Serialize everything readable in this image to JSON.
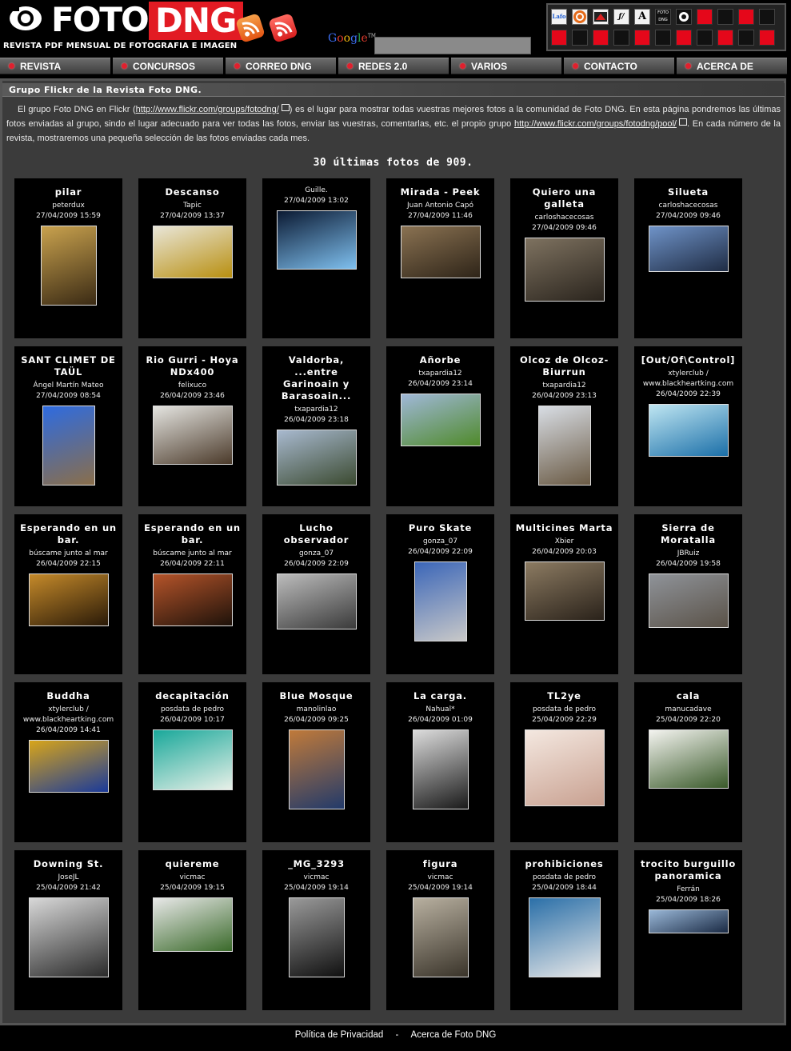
{
  "header": {
    "logo_foto": "FOTO",
    "logo_dng": "DNG",
    "logo_subtitle": "REVISTA PDF MENSUAL DE FOTOGRAFIA E IMAGEN",
    "google_label": "Google",
    "search_value": ""
  },
  "nav": [
    "REVISTA",
    "CONCURSOS",
    "CORREO DNG",
    "REDES 2.0",
    "VARIOS",
    "CONTACTO",
    "ACERCA DE"
  ],
  "section_title": "Grupo Flickr de la Revista Foto DNG.",
  "intro": {
    "p1": "El grupo Foto DNG en Flickr (",
    "link1": "http://www.flickr.com/groups/fotodng/",
    "p2": ") es el lugar para mostrar todas vuestras mejores fotos a la comunidad de Foto DNG. En esta página pondremos las últimas fotos enviadas al grupo, sindo el lugar adecuado para ver todas las fotos, enviar las vuestras, comentarlas, etc. el propio grupo ",
    "link2": "http://www.flickr.com/groups/fotodng/pool/",
    "p3": ". En cada número de la revista, mostraremos una pequeña selección de las fotos enviadas cada mes."
  },
  "count_text": "30 últimas fotos de 909.",
  "photos": [
    {
      "title": "pilar",
      "author": "peterdux",
      "date": "27/04/2009 15:59",
      "palette": [
        "#c9a24e",
        "#3a2a14"
      ]
    },
    {
      "title": "Descanso",
      "author": "Tapic",
      "date": "27/04/2009 13:37",
      "palette": [
        "#e9e6d8",
        "#b88f10"
      ]
    },
    {
      "title": "",
      "author": "Guille.",
      "date": "27/04/2009 13:02",
      "palette": [
        "#0b1a33",
        "#7fc0ef"
      ]
    },
    {
      "title": "Mirada - Peek",
      "author": "Juan Antonio Capó",
      "date": "27/04/2009 11:46",
      "palette": [
        "#8a7252",
        "#2e2418"
      ]
    },
    {
      "title": "Quiero una galleta",
      "author": "carloshacecosas",
      "date": "27/04/2009 09:46",
      "palette": [
        "#7e7260",
        "#2a241d"
      ]
    },
    {
      "title": "Silueta",
      "author": "carloshacecosas",
      "date": "27/04/2009 09:46",
      "palette": [
        "#6f93c8",
        "#1f2c44"
      ]
    },
    {
      "title": "SANT CLIMET DE TAÜL",
      "author": "Ángel Martín Mateo",
      "date": "27/04/2009 08:54",
      "palette": [
        "#2e6be0",
        "#8a6e4a"
      ]
    },
    {
      "title": "Rio Gurri - Hoya NDx400",
      "author": "felixuco",
      "date": "26/04/2009 23:46",
      "palette": [
        "#e4e4e0",
        "#4b3a2a"
      ]
    },
    {
      "title": "Valdorba, ...entre Garinoain y Barasoain...",
      "author": "txapardia12",
      "date": "26/04/2009 23:18",
      "palette": [
        "#a8b9cf",
        "#3b4a30"
      ]
    },
    {
      "title": "Añorbe",
      "author": "txapardia12",
      "date": "26/04/2009 23:14",
      "palette": [
        "#a0b8d8",
        "#4f8a2a"
      ]
    },
    {
      "title": "Olcoz de Olcoz-Biurrun",
      "author": "txapardia12",
      "date": "26/04/2009 23:13",
      "palette": [
        "#d8dde4",
        "#6a5a44"
      ]
    },
    {
      "title": "[Out/Of\\Control]",
      "author": "xtylerclub / www.blackheartking.com",
      "date": "26/04/2009 22:39",
      "palette": [
        "#bfe6f2",
        "#1b6fa8"
      ]
    },
    {
      "title": "Esperando en un bar.",
      "author": "búscame junto al mar",
      "date": "26/04/2009 22:15",
      "palette": [
        "#c58a2a",
        "#2a1a08"
      ]
    },
    {
      "title": "Esperando en un bar.",
      "author": "búscame junto al mar",
      "date": "26/04/2009 22:11",
      "palette": [
        "#b5542a",
        "#1e120a"
      ]
    },
    {
      "title": "Lucho observador",
      "author": "gonza_07",
      "date": "26/04/2009 22:09",
      "palette": [
        "#bcbcbc",
        "#3a3a3a"
      ]
    },
    {
      "title": "Puro Skate",
      "author": "gonza_07",
      "date": "26/04/2009 22:09",
      "palette": [
        "#3b66b8",
        "#c8c8c8"
      ]
    },
    {
      "title": "Multicines Marta",
      "author": "Xbier",
      "date": "26/04/2009 20:03",
      "palette": [
        "#8c7b62",
        "#2a221a"
      ]
    },
    {
      "title": "Sierra de Moratalla",
      "author": "JBRuiz",
      "date": "26/04/2009 19:58",
      "palette": [
        "#8f9399",
        "#5a5248"
      ]
    },
    {
      "title": "Buddha",
      "author": "xtylerclub / www.blackheartking.com",
      "date": "26/04/2009 14:41",
      "palette": [
        "#d8a51a",
        "#1a3a9a"
      ]
    },
    {
      "title": "decapitación",
      "author": "posdata de pedro",
      "date": "26/04/2009 10:17",
      "palette": [
        "#19a89a",
        "#e8f0e8"
      ]
    },
    {
      "title": "Blue Mosque",
      "author": "manolinlao",
      "date": "26/04/2009 09:25",
      "palette": [
        "#c07a3a",
        "#223a6a"
      ]
    },
    {
      "title": "La carga.",
      "author": "Nahual*",
      "date": "26/04/2009 01:09",
      "palette": [
        "#dcdcdc",
        "#1a1a1a"
      ]
    },
    {
      "title": "TL2ye",
      "author": "posdata de pedro",
      "date": "25/04/2009 22:29",
      "palette": [
        "#f4e8e0",
        "#c8a090"
      ]
    },
    {
      "title": "cala",
      "author": "manucadave",
      "date": "25/04/2009 22:20",
      "palette": [
        "#f4f4f0",
        "#3a5a2a"
      ]
    },
    {
      "title": "Downing St.",
      "author": "JoseJL",
      "date": "25/04/2009 21:42",
      "palette": [
        "#d8d8d8",
        "#2a2a2a"
      ]
    },
    {
      "title": "quiereme",
      "author": "vicmac",
      "date": "25/04/2009 19:15",
      "palette": [
        "#e8e8e8",
        "#3a6a2a"
      ]
    },
    {
      "title": "_MG_3293",
      "author": "vicmac",
      "date": "25/04/2009 19:14",
      "palette": [
        "#9a9a9a",
        "#101010"
      ]
    },
    {
      "title": "figura",
      "author": "vicmac",
      "date": "25/04/2009 19:14",
      "palette": [
        "#b8b0a0",
        "#3a342a"
      ]
    },
    {
      "title": "prohibiciones",
      "author": "posdata de pedro",
      "date": "25/04/2009 18:44",
      "palette": [
        "#2a6fa8",
        "#e8e8e8"
      ]
    },
    {
      "title": "trocito burguillo panoramica",
      "author": "Ferrán",
      "date": "25/04/2009 18:26",
      "palette": [
        "#9ab8d8",
        "#1a2a44"
      ]
    }
  ],
  "footer": {
    "privacy": "Política de Privacidad",
    "sep": "-",
    "about": "Acerca de Foto DNG"
  },
  "colors": {
    "accent": "#e21b23",
    "panel": "#3b3b3b",
    "card": "#000000"
  }
}
